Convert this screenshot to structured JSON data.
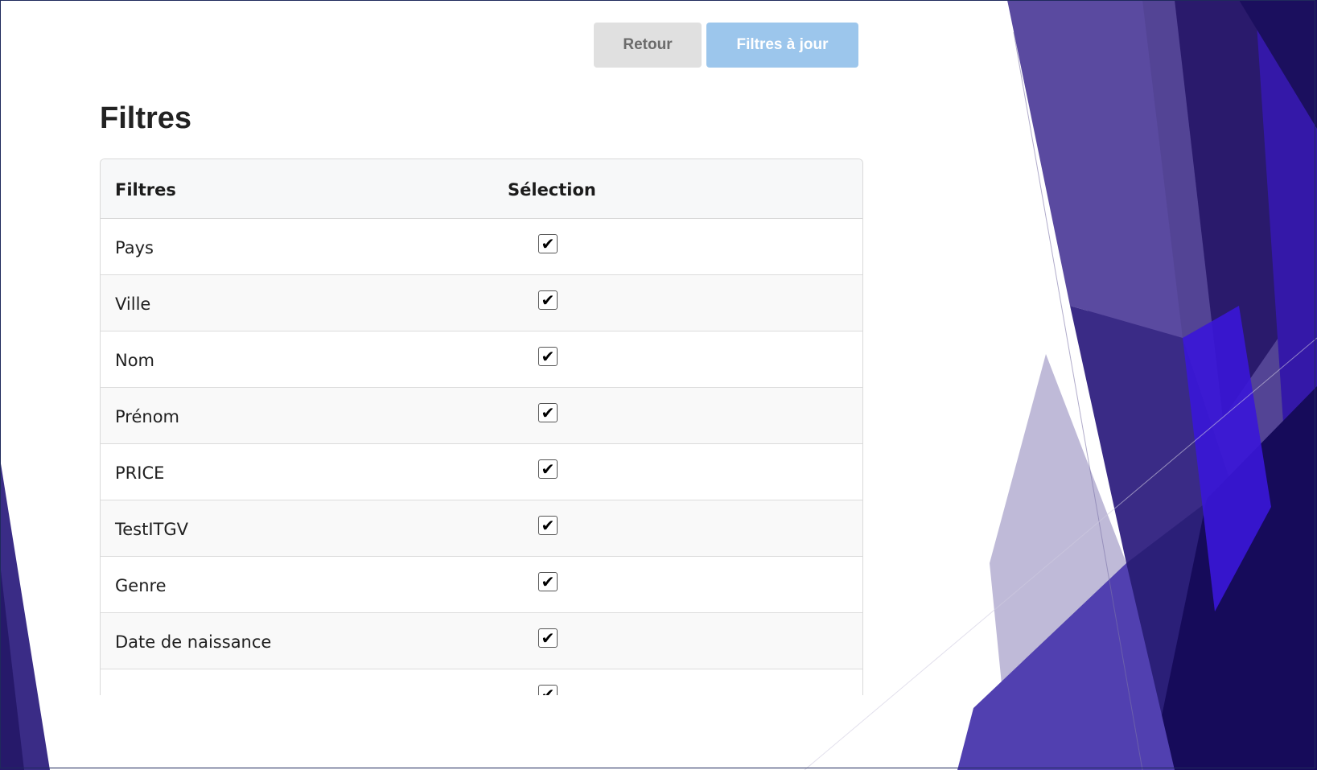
{
  "toolbar": {
    "back_label": "Retour",
    "update_label": "Filtres à jour"
  },
  "page": {
    "title": "Filtres"
  },
  "table": {
    "headers": {
      "name": "Filtres",
      "selection": "Sélection"
    },
    "rows": [
      {
        "label": "Pays",
        "checked": true
      },
      {
        "label": "Ville",
        "checked": true
      },
      {
        "label": "Nom",
        "checked": true
      },
      {
        "label": "Prénom",
        "checked": true
      },
      {
        "label": "PRICE",
        "checked": true
      },
      {
        "label": "TestITGV",
        "checked": true
      },
      {
        "label": "Genre",
        "checked": true
      },
      {
        "label": "Date de naissance",
        "checked": true
      },
      {
        "label": "",
        "checked": true
      }
    ],
    "check_glyph": "✔"
  },
  "colors": {
    "back_button": "#e0e0e0",
    "update_button": "#9cc6ec",
    "accent_purple": "#3b2c8c"
  }
}
